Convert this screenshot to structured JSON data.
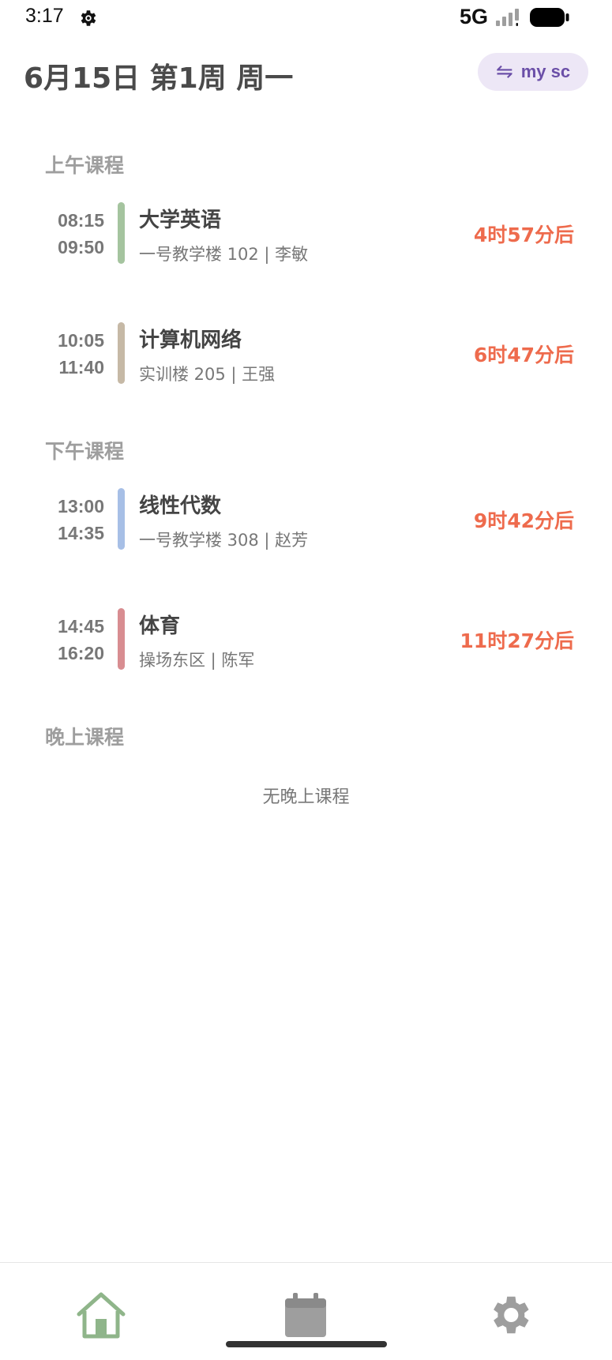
{
  "status_bar": {
    "time": "3:17",
    "network": "5G",
    "icons": [
      "gear-icon",
      "signal-icon",
      "battery-icon"
    ]
  },
  "header": {
    "title": "6月15日 第1周 周一",
    "schedule_chip": {
      "icon": "swap-icon",
      "label": "my sc"
    }
  },
  "sections": {
    "morning": {
      "title": "上午课程",
      "courses": [
        {
          "start": "08:15",
          "end": "09:50",
          "name": "大学英语",
          "info": "一号教学楼 102 | 李敏",
          "countdown": "4时57分后",
          "color": "#a5c49f"
        },
        {
          "start": "10:05",
          "end": "11:40",
          "name": "计算机网络",
          "info": "实训楼 205 | 王强",
          "countdown": "6时47分后",
          "color": "#c6b9a6"
        }
      ]
    },
    "afternoon": {
      "title": "下午课程",
      "courses": [
        {
          "start": "13:00",
          "end": "14:35",
          "name": "线性代数",
          "info": "一号教学楼 308 | 赵芳",
          "countdown": "9时42分后",
          "color": "#a7bfe6"
        },
        {
          "start": "14:45",
          "end": "16:20",
          "name": "体育",
          "info": "操场东区 | 陈军",
          "countdown": "11时27分后",
          "color": "#d88d91"
        }
      ]
    },
    "evening": {
      "title": "晚上课程",
      "empty_text": "无晚上课程"
    }
  },
  "bottom_nav": {
    "items": [
      {
        "icon": "home-icon",
        "active": true,
        "color": "#8fb58a"
      },
      {
        "icon": "calendar-icon",
        "active": false,
        "color": "#9e9e9e"
      },
      {
        "icon": "settings-gear-icon",
        "active": false,
        "color": "#9e9e9e"
      }
    ]
  },
  "colors": {
    "countdown": "#ee6b4d",
    "chip_bg": "#ede7f6",
    "chip_text": "#6b4fa8"
  }
}
